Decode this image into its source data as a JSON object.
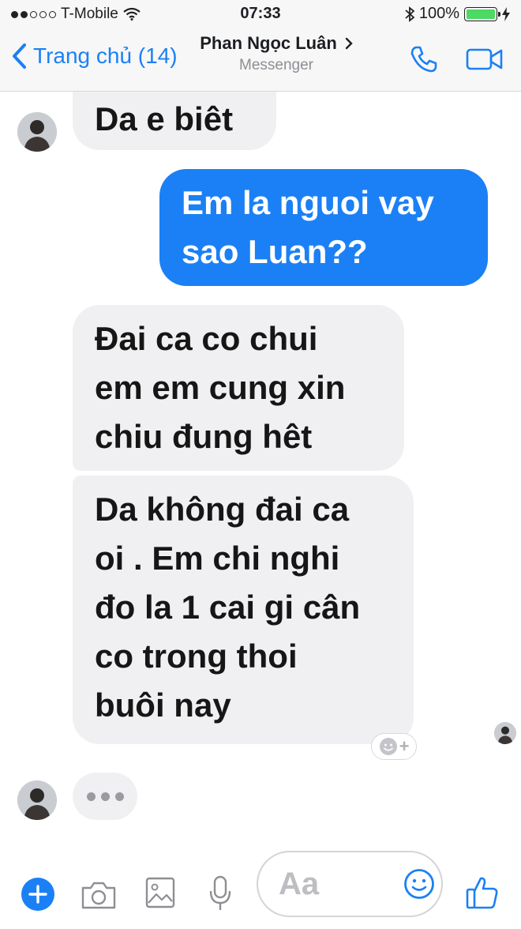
{
  "status_bar": {
    "carrier": "T-Mobile",
    "time": "07:33",
    "battery": "100%"
  },
  "header": {
    "back_label": "Trang chủ (14)",
    "contact_name": "Phan Ngọc Luân",
    "subtitle": "Messenger",
    "icons": [
      "back-chevron-icon",
      "chevron-right-icon",
      "phone-icon",
      "video-call-icon"
    ]
  },
  "messages": [
    {
      "sender": "contact",
      "lines": [
        "Da e biêt"
      ]
    },
    {
      "sender": "me",
      "lines": [
        "Em la nguoi vay",
        "sao Luan??"
      ]
    },
    {
      "sender": "contact",
      "lines": [
        "Đai ca co chui",
        "em em cung xin",
        "chiu đung hêt"
      ]
    },
    {
      "sender": "contact",
      "lines": [
        "Da không đai ca",
        "oi . Em chi nghi",
        "đo la 1 cai gi cân",
        "co trong thoi",
        "buôi nay"
      ]
    }
  ],
  "reaction_button": "+",
  "composer": {
    "placeholder": "Aa",
    "icons": [
      "plus-icon",
      "camera-icon",
      "image-icon",
      "microphone-icon",
      "emoji-icon",
      "thumbs-up-icon"
    ]
  },
  "colors": {
    "accent": "#1b80f5",
    "incoming_bubble": "#f0f0f2",
    "battery": "#4cd964"
  }
}
